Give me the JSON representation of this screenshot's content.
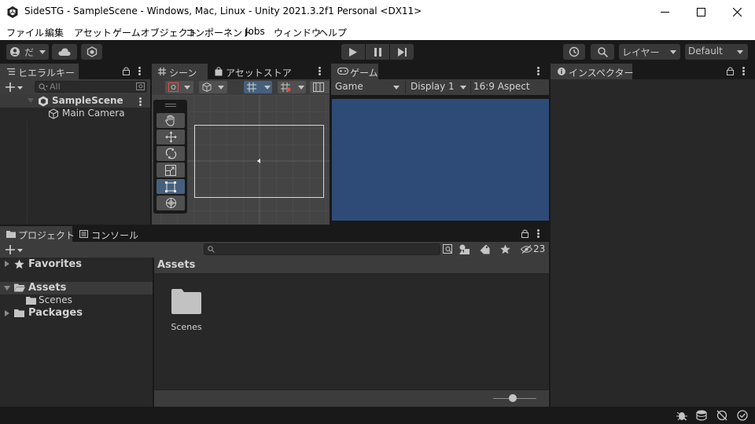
{
  "window": {
    "title": "SideSTG - SampleScene - Windows, Mac, Linux - Unity 2021.3.2f1 Personal <DX11>"
  },
  "menu": [
    "ファイル",
    "編集",
    "アセット",
    "ゲームオブジェクト",
    "コンポーネント",
    "Jobs",
    "ウィンドウ",
    "ヘルプ"
  ],
  "toolbar": {
    "account_label": "だ",
    "layers_label": "レイヤー",
    "layout_label": "Default"
  },
  "hierarchy": {
    "tab_label": "ヒエラルキー",
    "search_placeholder": "All",
    "scene_name": "SampleScene",
    "objects": [
      "Main Camera"
    ]
  },
  "scene_view": {
    "tab_scene": "シーン",
    "tab_assetstore": "アセットストア"
  },
  "game_view": {
    "tab_label": "ゲーム",
    "mode": "Game",
    "display": "Display 1",
    "aspect": "16:9 Aspect",
    "background_color": "#2e4b77"
  },
  "inspector": {
    "tab_label": "インスペクター"
  },
  "project": {
    "tab_project": "プロジェクト",
    "tab_console": "コンソール",
    "hidden_count": "23",
    "tree": {
      "favorites": "Favorites",
      "assets": "Assets",
      "scenes": "Scenes",
      "packages": "Packages"
    },
    "breadcrumb": "Assets",
    "items": [
      {
        "name": "Scenes",
        "icon": "folder-icon"
      }
    ]
  },
  "colors": {
    "accent": "#46607c",
    "panel": "#282828",
    "header": "#3c3c3c"
  }
}
